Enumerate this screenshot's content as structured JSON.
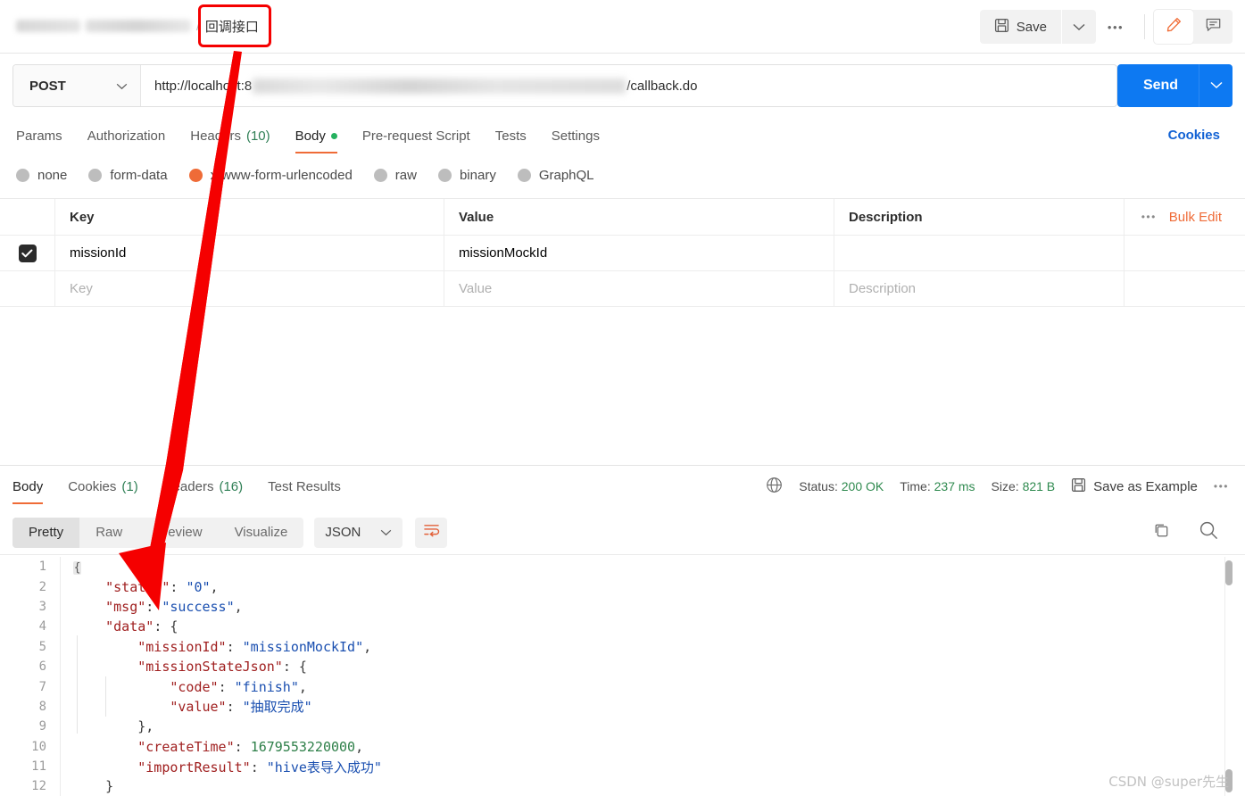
{
  "header": {
    "breadcrumb_separator": "/",
    "breadcrumb_current": "回调接口",
    "save_label": "Save",
    "more_label": "•••",
    "save_icon": "floppy-disk-icon",
    "caret_icon": "chevron-down-icon",
    "pencil_icon": "pencil-icon",
    "comment_icon": "comment-icon"
  },
  "request": {
    "method": "POST",
    "url_prefix": "http://localhost:8",
    "url_suffix": "/callback.do",
    "send_label": "Send",
    "tabs": [
      {
        "label": "Params",
        "count": "",
        "active": false,
        "dot": false
      },
      {
        "label": "Authorization",
        "count": "",
        "active": false,
        "dot": false
      },
      {
        "label": "Headers",
        "count": "(10)",
        "active": false,
        "dot": false
      },
      {
        "label": "Body",
        "count": "",
        "active": true,
        "dot": true
      },
      {
        "label": "Pre-request Script",
        "count": "",
        "active": false,
        "dot": false
      },
      {
        "label": "Tests",
        "count": "",
        "active": false,
        "dot": false
      },
      {
        "label": "Settings",
        "count": "",
        "active": false,
        "dot": false
      }
    ],
    "cookies_link": "Cookies",
    "body_types": [
      {
        "label": "none",
        "selected": false
      },
      {
        "label": "form-data",
        "selected": false
      },
      {
        "label": "x-www-form-urlencoded",
        "selected": true
      },
      {
        "label": "raw",
        "selected": false
      },
      {
        "label": "binary",
        "selected": false
      },
      {
        "label": "GraphQL",
        "selected": false
      }
    ],
    "table": {
      "headers": {
        "key": "Key",
        "value": "Value",
        "description": "Description"
      },
      "bulk_edit": "Bulk Edit",
      "bulk_dots": "•••",
      "rows": [
        {
          "checked": true,
          "key": "missionId",
          "value": "missionMockId",
          "description": ""
        }
      ],
      "placeholder_row": {
        "key": "Key",
        "value": "Value",
        "description": "Description"
      }
    }
  },
  "response": {
    "tabs": [
      {
        "label": "Body",
        "count": "",
        "active": true
      },
      {
        "label": "Cookies",
        "count": "(1)",
        "active": false
      },
      {
        "label": "Headers",
        "count": "(16)",
        "active": false
      },
      {
        "label": "Test Results",
        "count": "",
        "active": false
      }
    ],
    "globe_icon": "globe-icon",
    "status_label": "Status:",
    "status_value": "200 OK",
    "time_label": "Time:",
    "time_value": "237 ms",
    "size_label": "Size:",
    "size_value": "821 B",
    "save_example": "Save as Example",
    "more_label": "•••",
    "view_modes": [
      {
        "label": "Pretty",
        "active": true
      },
      {
        "label": "Raw",
        "active": false
      },
      {
        "label": "Preview",
        "active": false
      },
      {
        "label": "Visualize",
        "active": false
      }
    ],
    "format": "JSON",
    "wrap_icon": "wrap-lines-icon",
    "copy_icon": "copy-icon",
    "search_icon": "search-icon",
    "code_lines": [
      {
        "n": "1",
        "tokens": [
          {
            "t": "fold",
            "v": "{"
          }
        ]
      },
      {
        "n": "2",
        "tokens": [
          {
            "t": "punc",
            "v": "    "
          },
          {
            "t": "key",
            "v": "\"status\""
          },
          {
            "t": "punc",
            "v": ": "
          },
          {
            "t": "str",
            "v": "\"0\""
          },
          {
            "t": "punc",
            "v": ","
          }
        ]
      },
      {
        "n": "3",
        "tokens": [
          {
            "t": "punc",
            "v": "    "
          },
          {
            "t": "key",
            "v": "\"msg\""
          },
          {
            "t": "punc",
            "v": ": "
          },
          {
            "t": "str",
            "v": "\"success\""
          },
          {
            "t": "punc",
            "v": ","
          }
        ]
      },
      {
        "n": "4",
        "tokens": [
          {
            "t": "punc",
            "v": "    "
          },
          {
            "t": "key",
            "v": "\"data\""
          },
          {
            "t": "punc",
            "v": ": {"
          }
        ]
      },
      {
        "n": "5",
        "tokens": [
          {
            "t": "punc",
            "v": "        "
          },
          {
            "t": "key",
            "v": "\"missionId\""
          },
          {
            "t": "punc",
            "v": ": "
          },
          {
            "t": "str",
            "v": "\"missionMockId\""
          },
          {
            "t": "punc",
            "v": ","
          }
        ]
      },
      {
        "n": "6",
        "tokens": [
          {
            "t": "punc",
            "v": "        "
          },
          {
            "t": "key",
            "v": "\"missionStateJson\""
          },
          {
            "t": "punc",
            "v": ": {"
          }
        ]
      },
      {
        "n": "7",
        "tokens": [
          {
            "t": "punc",
            "v": "            "
          },
          {
            "t": "key",
            "v": "\"code\""
          },
          {
            "t": "punc",
            "v": ": "
          },
          {
            "t": "str",
            "v": "\"finish\""
          },
          {
            "t": "punc",
            "v": ","
          }
        ]
      },
      {
        "n": "8",
        "tokens": [
          {
            "t": "punc",
            "v": "            "
          },
          {
            "t": "key",
            "v": "\"value\""
          },
          {
            "t": "punc",
            "v": ": "
          },
          {
            "t": "str",
            "v": "\"抽取完成\""
          }
        ]
      },
      {
        "n": "9",
        "tokens": [
          {
            "t": "punc",
            "v": "        },"
          }
        ]
      },
      {
        "n": "10",
        "tokens": [
          {
            "t": "punc",
            "v": "        "
          },
          {
            "t": "key",
            "v": "\"createTime\""
          },
          {
            "t": "punc",
            "v": ": "
          },
          {
            "t": "num",
            "v": "1679553220000"
          },
          {
            "t": "punc",
            "v": ","
          }
        ]
      },
      {
        "n": "11",
        "tokens": [
          {
            "t": "punc",
            "v": "        "
          },
          {
            "t": "key",
            "v": "\"importResult\""
          },
          {
            "t": "punc",
            "v": ": "
          },
          {
            "t": "str",
            "v": "\"hive表导入成功\""
          }
        ]
      },
      {
        "n": "12",
        "tokens": [
          {
            "t": "punc",
            "v": "    }"
          }
        ]
      }
    ]
  },
  "annotation": {
    "box_color": "#f50000",
    "arrow_color": "#f50000"
  },
  "watermark": "CSDN @super先生"
}
